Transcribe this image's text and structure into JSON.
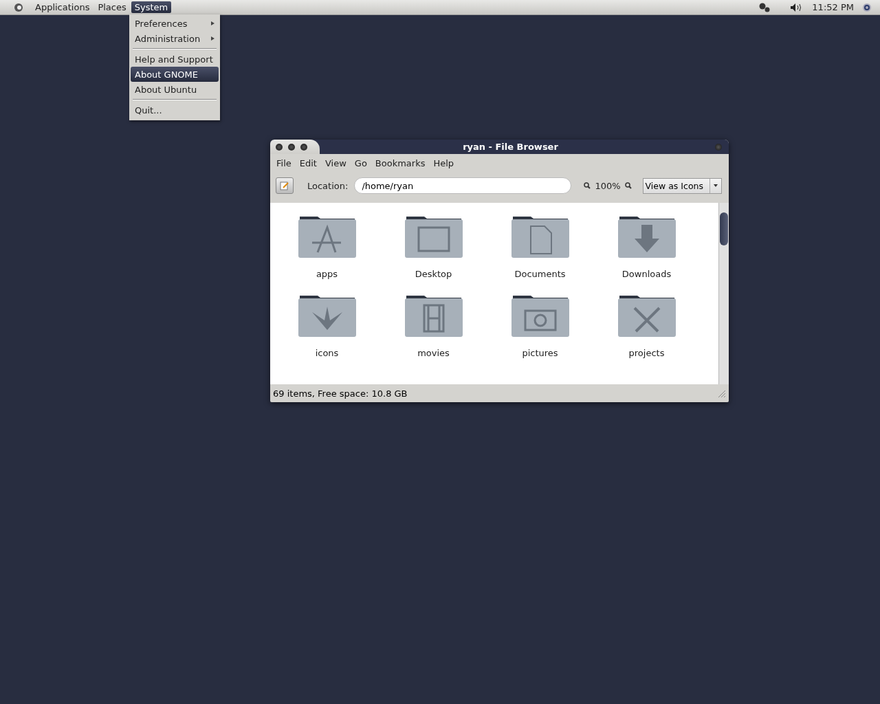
{
  "panel": {
    "menus": [
      {
        "label": "Applications",
        "selected": false
      },
      {
        "label": "Places",
        "selected": false
      },
      {
        "label": "System",
        "selected": true
      }
    ],
    "clock": "11:52 PM"
  },
  "system_menu": [
    {
      "kind": "item",
      "label": "Preferences",
      "submenu": true,
      "selected": false
    },
    {
      "kind": "item",
      "label": "Administration",
      "submenu": true,
      "selected": false
    },
    {
      "kind": "separator"
    },
    {
      "kind": "item",
      "label": "Help and Support",
      "submenu": false,
      "selected": false
    },
    {
      "kind": "item",
      "label": "About GNOME",
      "submenu": false,
      "selected": true
    },
    {
      "kind": "item",
      "label": "About Ubuntu",
      "submenu": false,
      "selected": false
    },
    {
      "kind": "separator"
    },
    {
      "kind": "item",
      "label": "Quit...",
      "submenu": false,
      "selected": false
    }
  ],
  "window": {
    "title": "ryan - File Browser",
    "menu": [
      "File",
      "Edit",
      "View",
      "Go",
      "Bookmarks",
      "Help"
    ],
    "location_label": "Location:",
    "location": "/home/ryan",
    "zoom": "100%",
    "view_mode": "View as Icons",
    "items": [
      {
        "name": "apps",
        "kind": "apps"
      },
      {
        "name": "Desktop",
        "kind": "desktop"
      },
      {
        "name": "Documents",
        "kind": "document"
      },
      {
        "name": "Downloads",
        "kind": "download"
      },
      {
        "name": "icons",
        "kind": "bird"
      },
      {
        "name": "movies",
        "kind": "film"
      },
      {
        "name": "pictures",
        "kind": "camera"
      },
      {
        "name": "projects",
        "kind": "tools"
      }
    ],
    "status": "69 items, Free space: 10.8 GB"
  }
}
